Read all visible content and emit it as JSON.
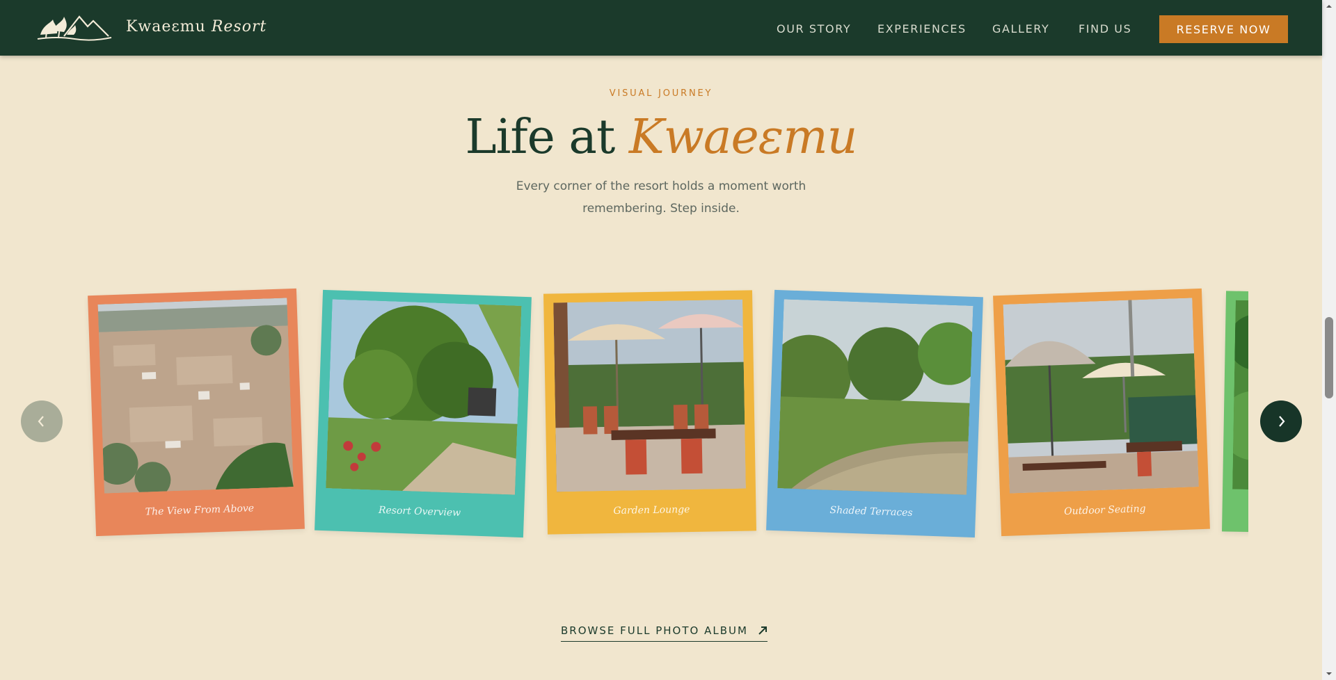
{
  "header": {
    "brand_name": "Kwaeɛmu",
    "brand_suffix": "Resort",
    "nav": [
      "OUR STORY",
      "EXPERIENCES",
      "GALLERY",
      "FIND US"
    ],
    "cta_label": "RESERVE NOW"
  },
  "section": {
    "eyebrow": "VISUAL JOURNEY",
    "title_plain": "Life at",
    "title_accent": "Kwaeɛmu",
    "subtitle": "Every corner of the resort holds a moment worth remembering. Step inside."
  },
  "gallery": {
    "cards": [
      {
        "caption": "The View From Above",
        "frame_color": "#e8865a"
      },
      {
        "caption": "Resort Overview",
        "frame_color": "#4cc0b0"
      },
      {
        "caption": "Garden Lounge",
        "frame_color": "#f0b63e"
      },
      {
        "caption": "Shaded Terraces",
        "frame_color": "#6aaed8"
      },
      {
        "caption": "Outdoor Seating",
        "frame_color": "#ee9f48"
      },
      {
        "caption": "",
        "frame_color": "#6ec26c"
      }
    ],
    "prev_icon": "chevron-left-icon",
    "next_icon": "chevron-right-icon"
  },
  "browse_link": {
    "label": "BROWSE FULL PHOTO ALBUM",
    "icon": "arrow-up-right-icon"
  },
  "colors": {
    "page_bg": "#f1e6ce",
    "header_bg": "#1b3a2b",
    "accent": "#c97a25"
  }
}
